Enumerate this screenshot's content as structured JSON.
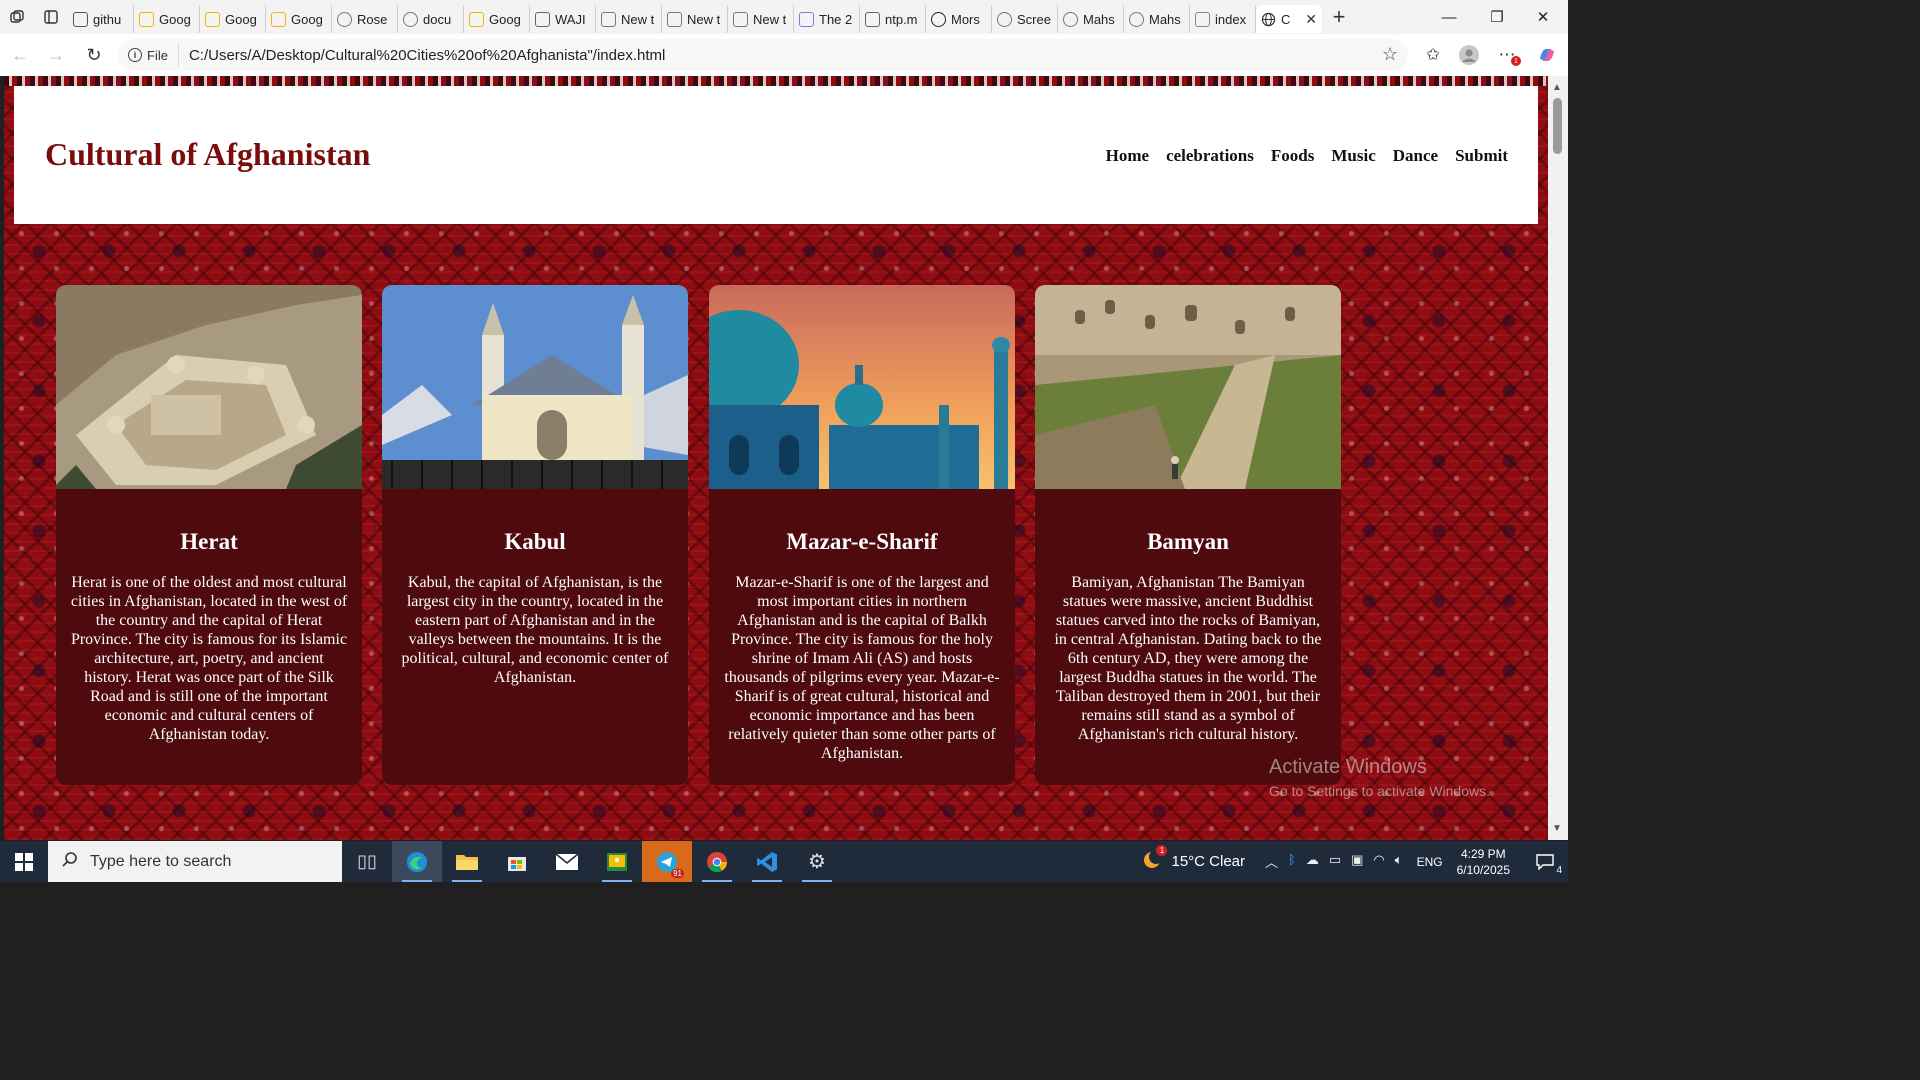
{
  "browser": {
    "tabs": [
      {
        "label": "githu",
        "icon": "github-icon",
        "color": "#555555"
      },
      {
        "label": "Goog",
        "icon": "google-classroom-icon",
        "color": "#f4b400"
      },
      {
        "label": "Goog",
        "icon": "google-classroom-icon",
        "color": "#f4b400"
      },
      {
        "label": "Goog",
        "icon": "google-classroom-icon",
        "color": "#f4b400"
      },
      {
        "label": "Rose",
        "icon": "globe-icon",
        "color": "#777777"
      },
      {
        "label": "docu",
        "icon": "globe-icon",
        "color": "#777777"
      },
      {
        "label": "Goog",
        "icon": "google-classroom-icon",
        "color": "#f4b400"
      },
      {
        "label": "WAJI",
        "icon": "wordpress-icon",
        "color": "#666666"
      },
      {
        "label": "New t",
        "icon": "new-tab-icon",
        "color": "#777777"
      },
      {
        "label": "New t",
        "icon": "new-tab-icon",
        "color": "#777777"
      },
      {
        "label": "New t",
        "icon": "new-tab-icon",
        "color": "#777777"
      },
      {
        "label": "The 2",
        "icon": "copilot-icon",
        "color": "#9b6be0"
      },
      {
        "label": "ntp.m",
        "icon": "document-icon",
        "color": "#666666"
      },
      {
        "label": "Mors",
        "icon": "globe-icon",
        "color": "#222222"
      },
      {
        "label": "Scree",
        "icon": "globe-icon",
        "color": "#777777"
      },
      {
        "label": "Mahs",
        "icon": "globe-icon",
        "color": "#777777"
      },
      {
        "label": "Mahs",
        "icon": "globe-icon",
        "color": "#777777"
      },
      {
        "label": "index",
        "icon": "folder-icon",
        "color": "#888888"
      }
    ],
    "active_tab": {
      "label": "C",
      "icon": "globe-icon"
    },
    "url_prefix": "File",
    "url": "C:/Users/A/Desktop/Cultural%20Cities%20of%20Afghanista\"/index.html"
  },
  "page": {
    "title": "Cultural of Afghanistan",
    "nav": [
      "Home",
      "celebrations",
      "Foods",
      "Music",
      "Dance",
      "Submit"
    ],
    "cards": [
      {
        "title": "Herat",
        "text": "Herat is one of the oldest and most cultural cities in Afghanistan, located in the west of the country and the capital of Herat Province. The city is famous for its Islamic architecture, art, poetry, and ancient history. Herat was once part of the Silk Road and is still one of the important economic and cultural centers of Afghanistan today."
      },
      {
        "title": "Kabul",
        "text": "Kabul, the capital of Afghanistan, is the largest city in the country, located in the eastern part of Afghanistan and in the valleys between the mountains. It is the political, cultural, and economic center of Afghanistan."
      },
      {
        "title": "Mazar-e-Sharif",
        "text": "Mazar-e-Sharif is one of the largest and most important cities in northern Afghanistan and is the capital of Balkh Province. The city is famous for the holy shrine of Imam Ali (AS) and hosts thousands of pilgrims every year. Mazar-e-Sharif is of great cultural, historical and economic importance and has been relatively quieter than some other parts of Afghanistan."
      },
      {
        "title": "Bamyan",
        "text": "Bamiyan, Afghanistan The Bamiyan statues were massive, ancient Buddhist statues carved into the rocks of Bamiyan, in central Afghanistan. Dating back to the 6th century AD, they were among the largest Buddha statues in the world. The Taliban destroyed them in 2001, but their remains still stand as a symbol of Afghanistan's rich cultural history."
      }
    ],
    "watermark": {
      "line1": "Activate Windows",
      "line2": "Go to Settings to activate Windows."
    }
  },
  "taskbar": {
    "search_placeholder": "Type here to search",
    "telegram_badge": "91",
    "weather": "15°C  Clear",
    "weather_badge": "1",
    "language": "ENG",
    "time": "4:29 PM",
    "date": "6/10/2025",
    "notification_count": "4"
  },
  "colors": {
    "title_red": "#7a0c0c",
    "card_bg": "#4e0a0c",
    "carpet": "#8e0d12"
  }
}
